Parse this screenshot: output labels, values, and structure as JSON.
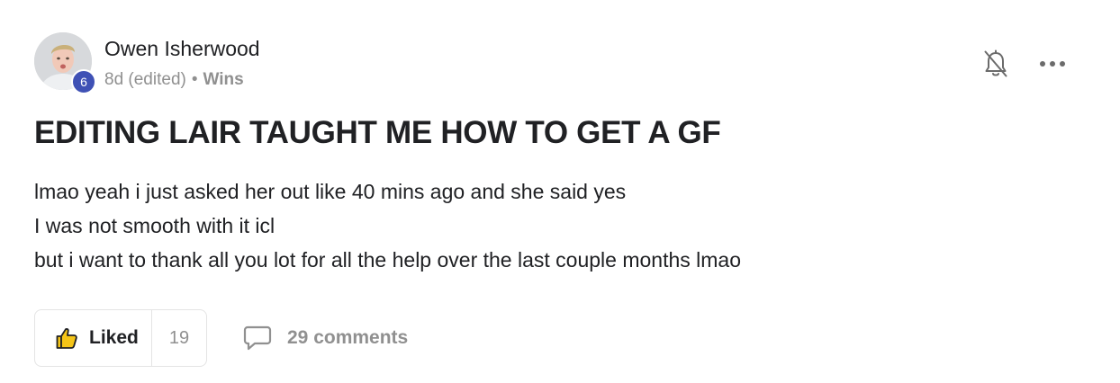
{
  "post": {
    "author": {
      "name": "Owen Isherwood",
      "level": "6",
      "avatar_icon": "user-photo"
    },
    "meta": {
      "age": "8d (edited)",
      "separator": "•",
      "category": "Wins"
    },
    "actions": {
      "notifications_icon": "bell-off-icon",
      "more_icon": "more-horizontal-icon"
    },
    "title": "EDITING LAIR TAUGHT ME HOW TO GET A GF",
    "body_lines": [
      "lmao yeah i just asked her out like 40 mins ago and she said yes",
      "I was not smooth with it icl",
      "but i want to thank all you lot for all the help over the last couple months lmao"
    ],
    "footer": {
      "like_label": "Liked",
      "like_count": "19",
      "comments_label": "29 comments"
    },
    "colors": {
      "level_badge": "#3f51b5",
      "like_icon_fill": "#f5c518",
      "muted_text": "#909090"
    }
  }
}
